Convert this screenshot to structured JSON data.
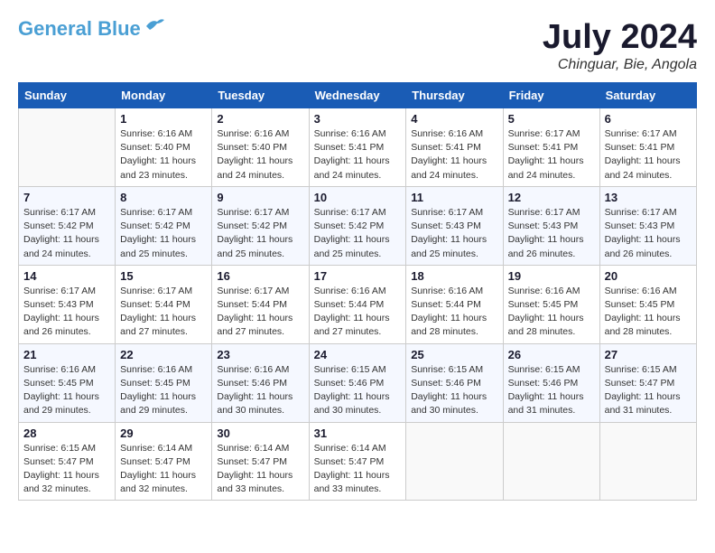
{
  "header": {
    "logo_line1": "General",
    "logo_line2": "Blue",
    "month_title": "July 2024",
    "location": "Chinguar, Bie, Angola"
  },
  "weekdays": [
    "Sunday",
    "Monday",
    "Tuesday",
    "Wednesday",
    "Thursday",
    "Friday",
    "Saturday"
  ],
  "weeks": [
    [
      {
        "day": "",
        "info": ""
      },
      {
        "day": "1",
        "info": "Sunrise: 6:16 AM\nSunset: 5:40 PM\nDaylight: 11 hours\nand 23 minutes."
      },
      {
        "day": "2",
        "info": "Sunrise: 6:16 AM\nSunset: 5:40 PM\nDaylight: 11 hours\nand 24 minutes."
      },
      {
        "day": "3",
        "info": "Sunrise: 6:16 AM\nSunset: 5:41 PM\nDaylight: 11 hours\nand 24 minutes."
      },
      {
        "day": "4",
        "info": "Sunrise: 6:16 AM\nSunset: 5:41 PM\nDaylight: 11 hours\nand 24 minutes."
      },
      {
        "day": "5",
        "info": "Sunrise: 6:17 AM\nSunset: 5:41 PM\nDaylight: 11 hours\nand 24 minutes."
      },
      {
        "day": "6",
        "info": "Sunrise: 6:17 AM\nSunset: 5:41 PM\nDaylight: 11 hours\nand 24 minutes."
      }
    ],
    [
      {
        "day": "7",
        "info": "Sunrise: 6:17 AM\nSunset: 5:42 PM\nDaylight: 11 hours\nand 24 minutes."
      },
      {
        "day": "8",
        "info": "Sunrise: 6:17 AM\nSunset: 5:42 PM\nDaylight: 11 hours\nand 25 minutes."
      },
      {
        "day": "9",
        "info": "Sunrise: 6:17 AM\nSunset: 5:42 PM\nDaylight: 11 hours\nand 25 minutes."
      },
      {
        "day": "10",
        "info": "Sunrise: 6:17 AM\nSunset: 5:42 PM\nDaylight: 11 hours\nand 25 minutes."
      },
      {
        "day": "11",
        "info": "Sunrise: 6:17 AM\nSunset: 5:43 PM\nDaylight: 11 hours\nand 25 minutes."
      },
      {
        "day": "12",
        "info": "Sunrise: 6:17 AM\nSunset: 5:43 PM\nDaylight: 11 hours\nand 26 minutes."
      },
      {
        "day": "13",
        "info": "Sunrise: 6:17 AM\nSunset: 5:43 PM\nDaylight: 11 hours\nand 26 minutes."
      }
    ],
    [
      {
        "day": "14",
        "info": "Sunrise: 6:17 AM\nSunset: 5:43 PM\nDaylight: 11 hours\nand 26 minutes."
      },
      {
        "day": "15",
        "info": "Sunrise: 6:17 AM\nSunset: 5:44 PM\nDaylight: 11 hours\nand 27 minutes."
      },
      {
        "day": "16",
        "info": "Sunrise: 6:17 AM\nSunset: 5:44 PM\nDaylight: 11 hours\nand 27 minutes."
      },
      {
        "day": "17",
        "info": "Sunrise: 6:16 AM\nSunset: 5:44 PM\nDaylight: 11 hours\nand 27 minutes."
      },
      {
        "day": "18",
        "info": "Sunrise: 6:16 AM\nSunset: 5:44 PM\nDaylight: 11 hours\nand 28 minutes."
      },
      {
        "day": "19",
        "info": "Sunrise: 6:16 AM\nSunset: 5:45 PM\nDaylight: 11 hours\nand 28 minutes."
      },
      {
        "day": "20",
        "info": "Sunrise: 6:16 AM\nSunset: 5:45 PM\nDaylight: 11 hours\nand 28 minutes."
      }
    ],
    [
      {
        "day": "21",
        "info": "Sunrise: 6:16 AM\nSunset: 5:45 PM\nDaylight: 11 hours\nand 29 minutes."
      },
      {
        "day": "22",
        "info": "Sunrise: 6:16 AM\nSunset: 5:45 PM\nDaylight: 11 hours\nand 29 minutes."
      },
      {
        "day": "23",
        "info": "Sunrise: 6:16 AM\nSunset: 5:46 PM\nDaylight: 11 hours\nand 30 minutes."
      },
      {
        "day": "24",
        "info": "Sunrise: 6:15 AM\nSunset: 5:46 PM\nDaylight: 11 hours\nand 30 minutes."
      },
      {
        "day": "25",
        "info": "Sunrise: 6:15 AM\nSunset: 5:46 PM\nDaylight: 11 hours\nand 30 minutes."
      },
      {
        "day": "26",
        "info": "Sunrise: 6:15 AM\nSunset: 5:46 PM\nDaylight: 11 hours\nand 31 minutes."
      },
      {
        "day": "27",
        "info": "Sunrise: 6:15 AM\nSunset: 5:47 PM\nDaylight: 11 hours\nand 31 minutes."
      }
    ],
    [
      {
        "day": "28",
        "info": "Sunrise: 6:15 AM\nSunset: 5:47 PM\nDaylight: 11 hours\nand 32 minutes."
      },
      {
        "day": "29",
        "info": "Sunrise: 6:14 AM\nSunset: 5:47 PM\nDaylight: 11 hours\nand 32 minutes."
      },
      {
        "day": "30",
        "info": "Sunrise: 6:14 AM\nSunset: 5:47 PM\nDaylight: 11 hours\nand 33 minutes."
      },
      {
        "day": "31",
        "info": "Sunrise: 6:14 AM\nSunset: 5:47 PM\nDaylight: 11 hours\nand 33 minutes."
      },
      {
        "day": "",
        "info": ""
      },
      {
        "day": "",
        "info": ""
      },
      {
        "day": "",
        "info": ""
      }
    ]
  ]
}
